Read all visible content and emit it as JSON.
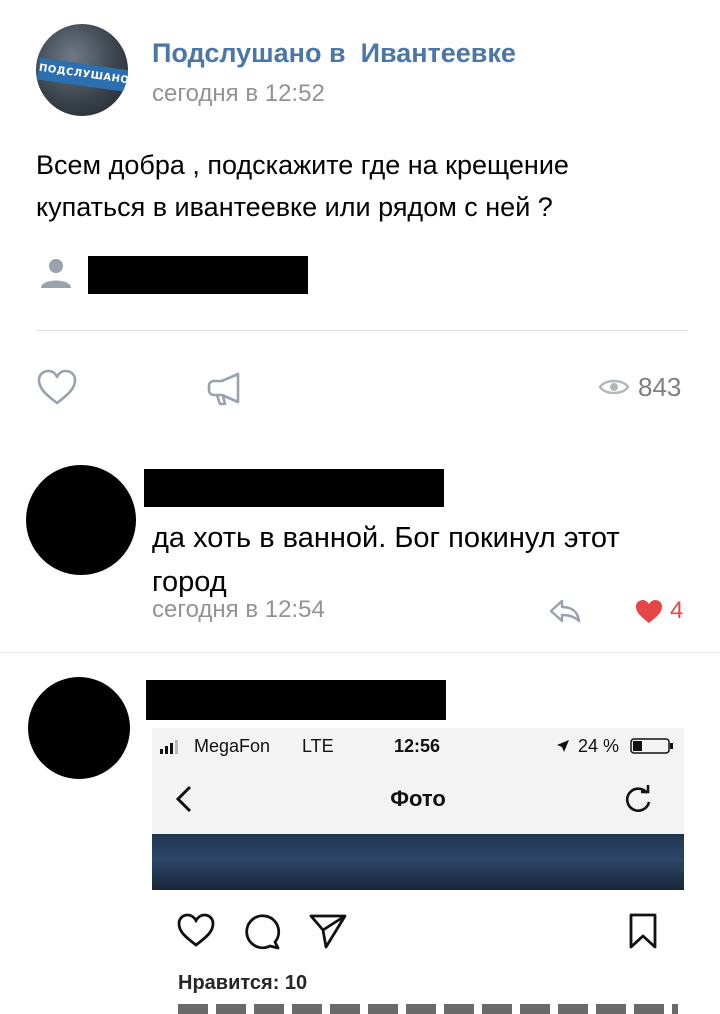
{
  "post": {
    "group_name": "Подслушано в  Ивантеевке",
    "time": "сегодня в 12:52",
    "avatar_text": "ПОДСЛУШАНО",
    "text_lines": [
      "Всем добра , подскажите где на крещение",
      "купаться в ивантеевке или рядом с ней ?"
    ],
    "views": "843"
  },
  "comments": [
    {
      "text_lines": [
        "да хоть в ванной. Бог покинул этот",
        "город"
      ],
      "time": "сегодня в 12:54",
      "likes": "4"
    },
    {
      "screenshot": {
        "carrier": "MegaFon",
        "network": "LTE",
        "clock": "12:56",
        "battery": "24 %",
        "title": "Фото",
        "likes_label": "Нравится: 10"
      }
    }
  ],
  "colors": {
    "link_blue": "#4a76a8",
    "meta_gray": "#939393",
    "icon_gray": "#99a2ad",
    "like_red": "#e64646"
  },
  "icons": {
    "like": "heart-icon",
    "share": "megaphone-icon",
    "views": "eye-icon",
    "reply": "reply-icon",
    "liked": "heart-filled-icon"
  }
}
